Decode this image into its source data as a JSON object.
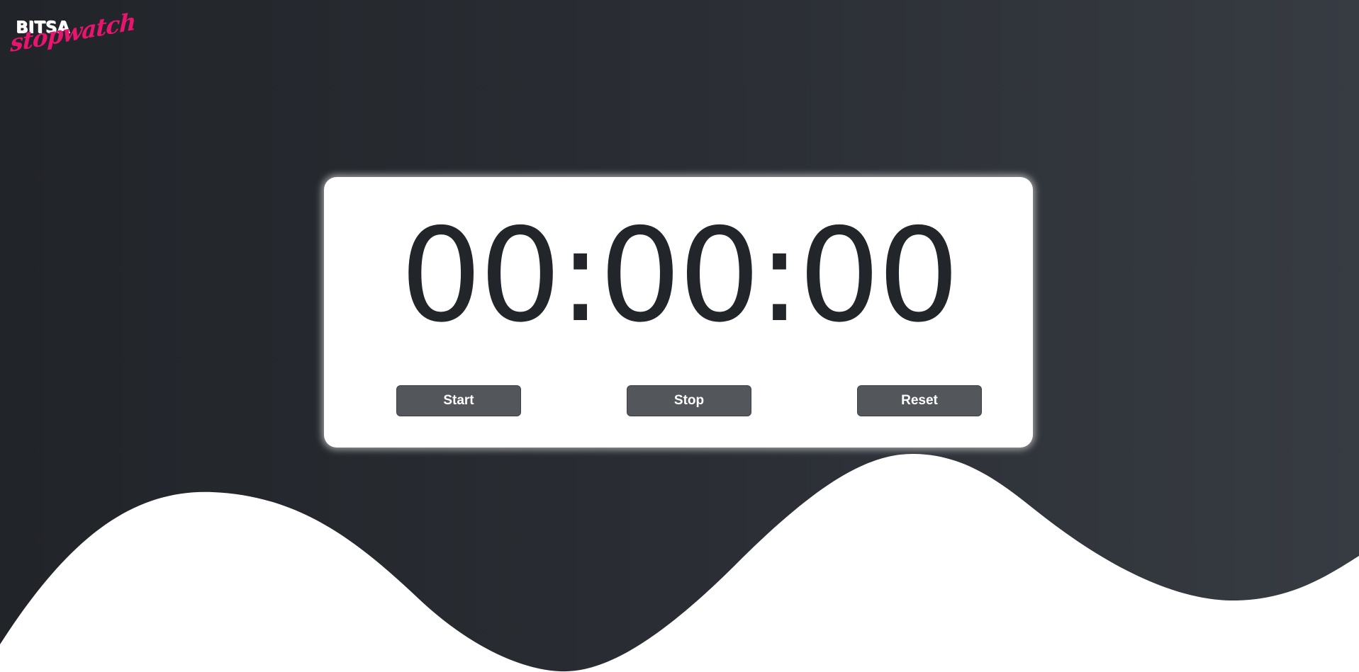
{
  "logo": {
    "top_text": "BITSA",
    "bottom_text": "stopwatch"
  },
  "stopwatch": {
    "display": "00:00:00"
  },
  "controls": {
    "start_label": "Start",
    "stop_label": "Stop",
    "reset_label": "Reset"
  },
  "colors": {
    "background_dark": "#212429",
    "background_light": "#373b42",
    "card": "#ffffff",
    "button": "#53575b",
    "logo_accent": "#e8156f",
    "wave": "#ffffff"
  }
}
